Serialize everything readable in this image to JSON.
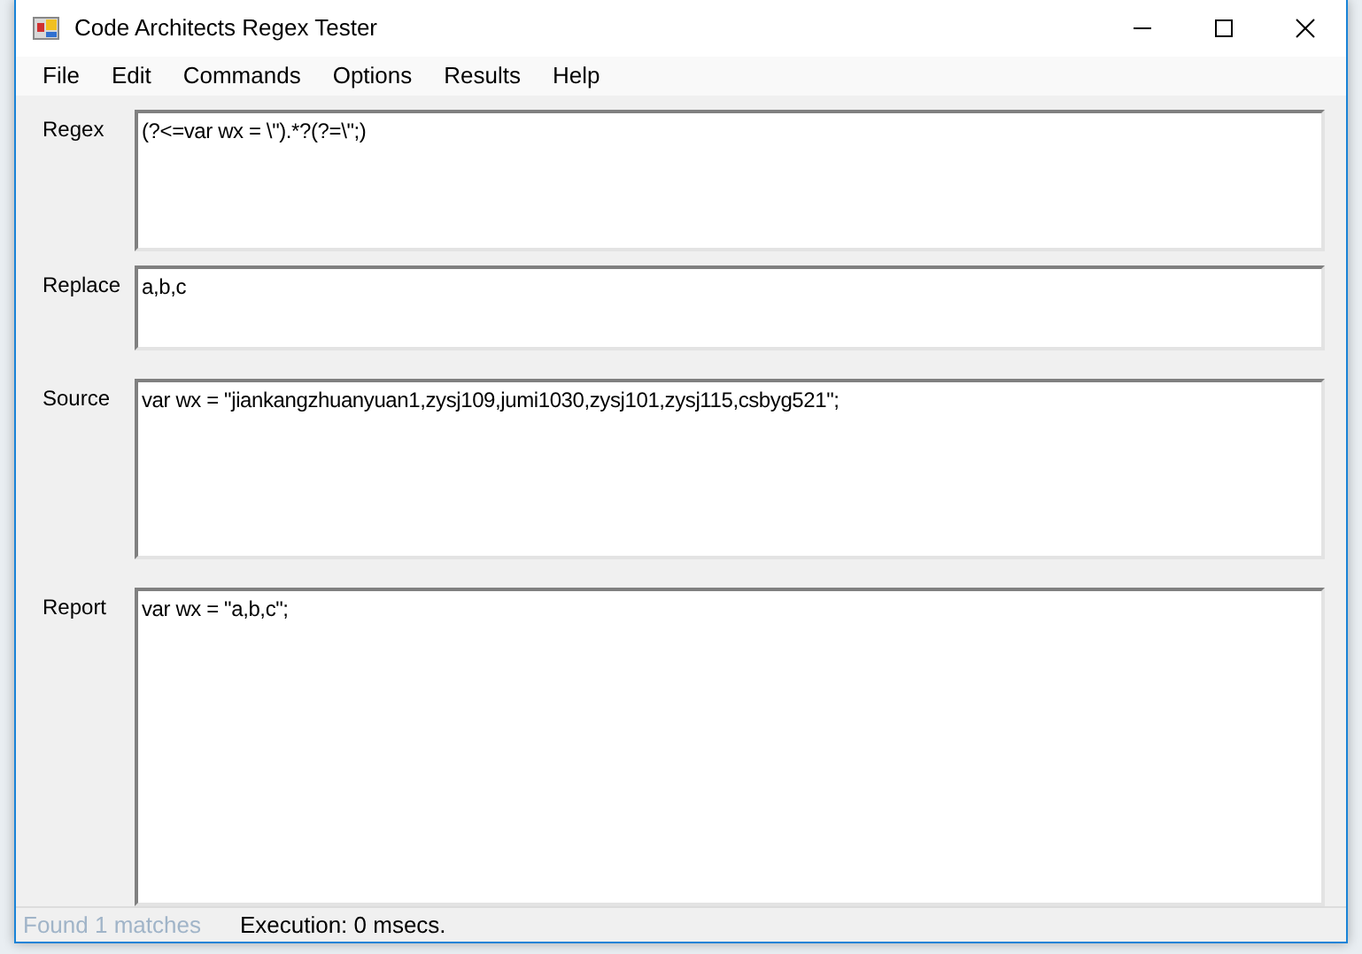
{
  "window": {
    "title": "Code Architects Regex Tester"
  },
  "menu": [
    "File",
    "Edit",
    "Commands",
    "Options",
    "Results",
    "Help"
  ],
  "fields": [
    {
      "label": "Regex",
      "value": "(?<=var wx = \\\").*?(?=\\\";)"
    },
    {
      "label": "Replace",
      "value": "a,b,c"
    },
    {
      "label": "Source",
      "value": "var wx = \"jiankangzhuanyuan1,zysj109,jumi1030,zysj101,zysj115,csbyg521\";"
    },
    {
      "label": "Report",
      "value": "var wx = \"a,b,c\";"
    }
  ],
  "status_bar": [
    {
      "text": "Found 1 matches",
      "disabled": true
    },
    {
      "text": "Execution: 0 msecs.",
      "disabled": false
    }
  ]
}
